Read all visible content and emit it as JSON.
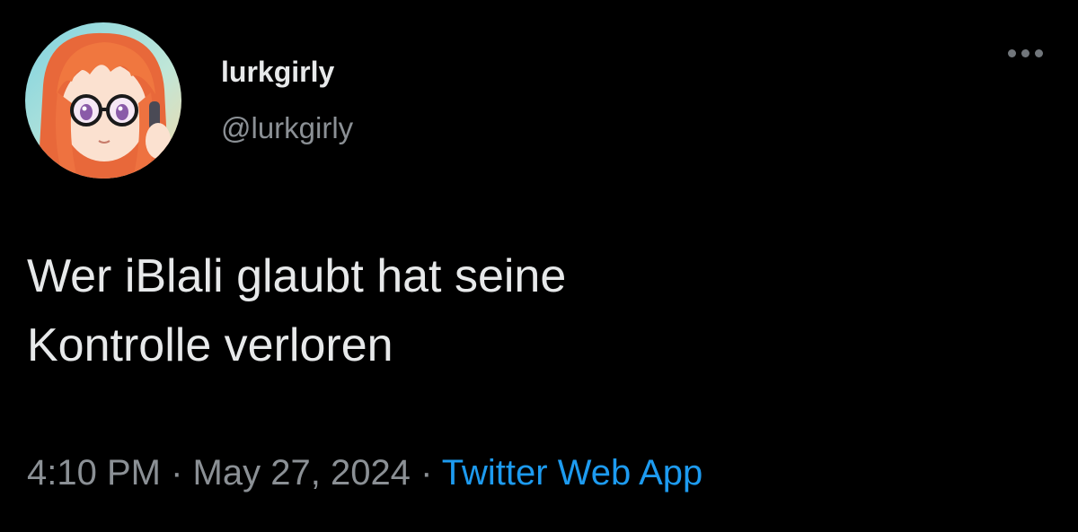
{
  "user": {
    "display_name": "lurkgirly",
    "handle": "@lurkgirly",
    "avatar_icon": "anime-girl-avatar"
  },
  "more_icon": "more-horizontal-icon",
  "tweet": {
    "lines": [
      "Wer iBlali glaubt hat seine",
      "Kontrolle verloren"
    ]
  },
  "meta": {
    "time": "4:10 PM",
    "date": "May 27, 2024",
    "separator": "·",
    "source": "Twitter Web App"
  },
  "colors": {
    "background": "#000000",
    "text_primary": "#e7e9ea",
    "text_secondary": "#8b9095",
    "link": "#1d9bf0"
  }
}
